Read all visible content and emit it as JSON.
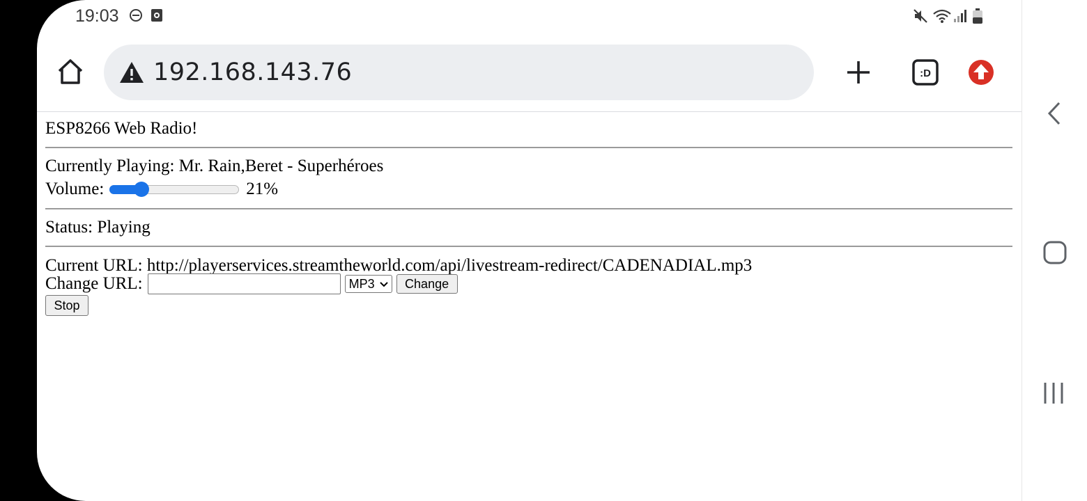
{
  "status_bar": {
    "time": "19:03",
    "icons": [
      "do-not-disturb-icon",
      "screen-record-icon",
      "mute-icon",
      "wifi-icon",
      "signal-icon",
      "battery-icon"
    ]
  },
  "browser": {
    "url": "192.168.143.76",
    "icons": [
      "home-icon",
      "not-secure-warning-icon",
      "new-tab-plus-icon",
      "tab-switcher-icon",
      "update-arrow-icon"
    ],
    "tab_switcher_label": ":D",
    "accent_update_color": "#d93025"
  },
  "page": {
    "heading": "ESP8266 Web Radio!",
    "currently_playing_label": "Currently Playing:",
    "currently_playing_value": "Mr. Rain,Beret - Superhéroes",
    "volume_label": "Volume:",
    "volume_percent": 21,
    "volume_text": "21%",
    "status_label": "Status:",
    "status_value": "Playing",
    "current_url_label": "Current URL:",
    "current_url_value": "http://playerservices.streamtheworld.com/api/livestream-redirect/CADENADIAL.mp3",
    "change_url_label": "Change URL:",
    "change_url_input_value": "",
    "format_selected": "MP3",
    "change_button": "Change",
    "stop_button": "Stop"
  },
  "nav": {
    "icons": [
      "back-icon",
      "home-square-icon",
      "recents-icon"
    ]
  },
  "colors": {
    "slider_accent": "#1a73e8",
    "url_bar_bg": "#eceef1"
  }
}
